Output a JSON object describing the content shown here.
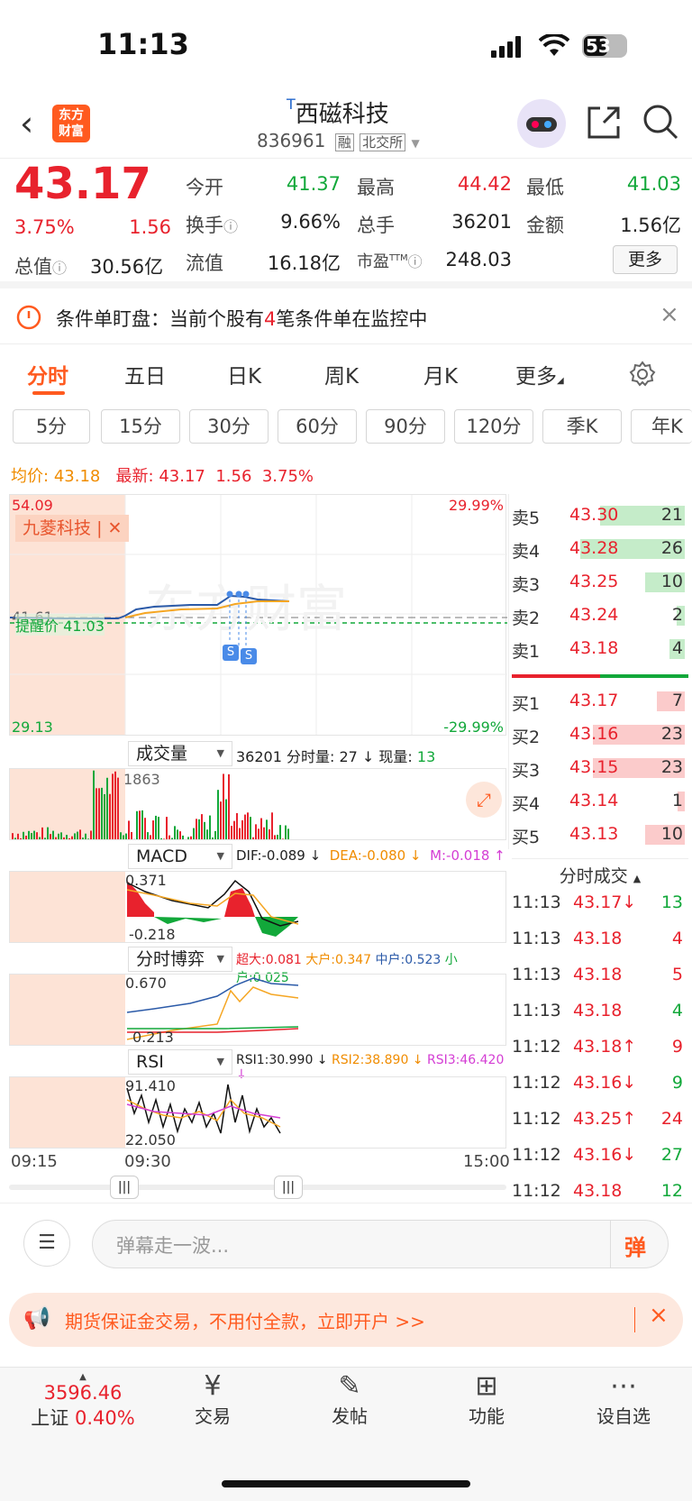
{
  "status_bar": {
    "time": "11:13",
    "battery": "53"
  },
  "header": {
    "title": "西磁科技",
    "title_prefix": "T",
    "code": "836961",
    "tag1": "融",
    "tag2": "北交所",
    "logo_line1": "东方",
    "logo_line2": "财富"
  },
  "quote": {
    "price": "43.17",
    "change_pct": "3.75%",
    "change": "1.56",
    "open_label": "今开",
    "open": "41.37",
    "high_label": "最高",
    "high": "44.42",
    "low_label": "最低",
    "low": "41.03",
    "turnover_label": "换手",
    "turnover": "9.66%",
    "volume_label": "总手",
    "volume": "36201",
    "amount_label": "金额",
    "amount": "1.56亿",
    "mktcap_label": "总值",
    "mktcap": "30.56亿",
    "float_label": "流值",
    "float_cap": "16.18亿",
    "pe_label": "市盈",
    "pe_sup": "TTM",
    "pe": "248.03",
    "more_label": "更多"
  },
  "notice": {
    "prefix": "条件单盯盘：当前个股有",
    "count": "4",
    "suffix": "笔条件单在监控中"
  },
  "tabs": [
    "分时",
    "五日",
    "日K",
    "周K",
    "月K",
    "更多"
  ],
  "periods": [
    "5分",
    "15分",
    "30分",
    "60分",
    "90分",
    "120分",
    "季K",
    "年K"
  ],
  "avg_line": {
    "avg_label": "均价:",
    "avg": "43.18",
    "latest_label": "最新:",
    "latest": "43.17",
    "chg": "1.56",
    "pct": "3.75%"
  },
  "chart": {
    "y_top": "54.09",
    "y_bottom": "29.13",
    "pct_top": "29.99%",
    "pct_bottom": "-29.99%",
    "base": "41.61",
    "alert": "提醒价 41.03",
    "compare": "九菱科技",
    "marker": "S",
    "t_start": "09:15",
    "t_mid": "09:30",
    "t_end": "15:00"
  },
  "volume": {
    "selector": "成交量",
    "total": "36201",
    "minute_label": "分时量: 27",
    "now_label": "现量:",
    "now": "13",
    "axis": "1863"
  },
  "macd": {
    "selector": "MACD",
    "dif": "DIF:-0.089 ↓",
    "dea": "DEA:-0.080 ↓",
    "m": "M:-0.018 ↑",
    "top": "0.371",
    "bottom": "-0.218"
  },
  "game": {
    "selector": "分时博弈",
    "big": "超大:0.081",
    "large": "大户:0.347",
    "mid": "中户:0.523",
    "small": "小户:0.025",
    "top": "0.670",
    "bottom": "0.213"
  },
  "rsi": {
    "selector": "RSI",
    "r1": "RSI1:30.990 ↓",
    "r2": "RSI2:38.890 ↓",
    "r3": "RSI3:46.420 ↓",
    "top": "91.410",
    "bottom": "22.050"
  },
  "orderbook": {
    "asks": [
      {
        "label": "卖5",
        "price": "43.30",
        "vol": "21",
        "frac": 0.81
      },
      {
        "label": "卖4",
        "price": "43.28",
        "vol": "26",
        "frac": 1.0
      },
      {
        "label": "卖3",
        "price": "43.25",
        "vol": "10",
        "frac": 0.38
      },
      {
        "label": "卖2",
        "price": "43.24",
        "vol": "2",
        "frac": 0.08
      },
      {
        "label": "卖1",
        "price": "43.18",
        "vol": "4",
        "frac": 0.15
      }
    ],
    "bids": [
      {
        "label": "买1",
        "price": "43.17",
        "vol": "7",
        "frac": 0.27
      },
      {
        "label": "买2",
        "price": "43.16",
        "vol": "23",
        "frac": 0.88
      },
      {
        "label": "买3",
        "price": "43.15",
        "vol": "23",
        "frac": 0.88
      },
      {
        "label": "买4",
        "price": "43.14",
        "vol": "1",
        "frac": 0.04
      },
      {
        "label": "买5",
        "price": "43.13",
        "vol": "10",
        "frac": 0.38
      }
    ]
  },
  "ticks_title": "分时成交",
  "ticks": [
    {
      "time": "11:13",
      "price": "43.17↓",
      "vol": "13",
      "pc": "red",
      "vc": "green"
    },
    {
      "time": "11:13",
      "price": "43.18",
      "vol": "4",
      "pc": "red",
      "vc": "red"
    },
    {
      "time": "11:13",
      "price": "43.18",
      "vol": "5",
      "pc": "red",
      "vc": "red"
    },
    {
      "time": "11:13",
      "price": "43.18",
      "vol": "4",
      "pc": "red",
      "vc": "green"
    },
    {
      "time": "11:12",
      "price": "43.18↑",
      "vol": "9",
      "pc": "red",
      "vc": "red"
    },
    {
      "time": "11:12",
      "price": "43.16↓",
      "vol": "9",
      "pc": "red",
      "vc": "green"
    },
    {
      "time": "11:12",
      "price": "43.25↑",
      "vol": "24",
      "pc": "red",
      "vc": "red"
    },
    {
      "time": "11:12",
      "price": "43.16↓",
      "vol": "27",
      "pc": "red",
      "vc": "green"
    },
    {
      "time": "11:12",
      "price": "43.18",
      "vol": "12",
      "pc": "red",
      "vc": "green"
    }
  ],
  "comment": {
    "placeholder": "弹幕走一波...",
    "danmu": "弹"
  },
  "ad": {
    "text": "期货保证金交易，不用付全款，立即开户 >>"
  },
  "bottom_nav": {
    "index_value": "3596.46",
    "index_name": "上证",
    "index_pct": "0.40%",
    "items": [
      "交易",
      "发帖",
      "功能",
      "设自选"
    ]
  },
  "colors": {
    "up": "#e8222d",
    "down": "#12a83a",
    "accent": "#ff5a1f"
  }
}
